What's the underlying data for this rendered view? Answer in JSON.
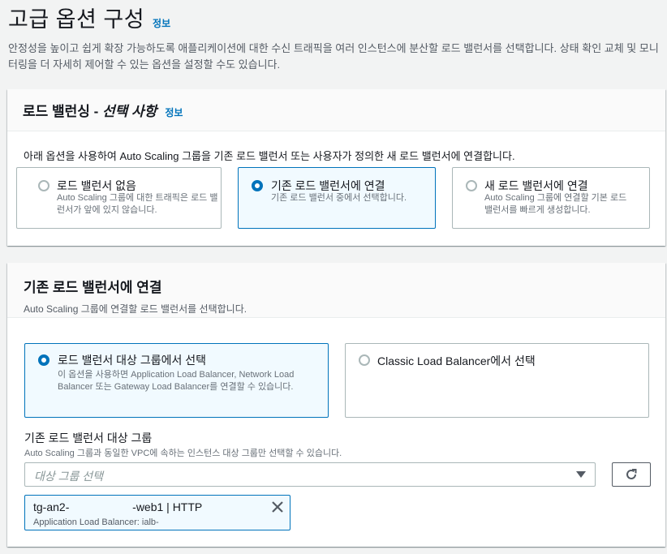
{
  "header": {
    "title": "고급 옵션 구성",
    "info": "정보",
    "description": "안정성을 높이고 쉽게 확장 가능하도록 애플리케이션에 대한 수신 트래픽을 여러 인스턴스에 분산할 로드 밸런서를 선택합니다. 상태 확인 교체 및 모니터링을 더 자세히 제어할 수 있는 옵션을 설정할 수도 있습니다."
  },
  "load_balancing": {
    "title_main": "로드 밸런싱 - ",
    "title_optional": "선택 사항",
    "info": "정보",
    "intro": "아래 옵션을 사용하여 Auto Scaling 그룹을 기존 로드 밸런서 또는 사용자가 정의한 새 로드 밸런서에 연결합니다.",
    "options": [
      {
        "title": "로드 밸런서 없음",
        "desc": "Auto Scaling 그룹에 대한 트래픽은 로드 밸런서가 앞에 있지 않습니다.",
        "selected": false
      },
      {
        "title": "기존 로드 밸런서에 연결",
        "desc": "기존 로드 밸런서 중에서 선택합니다.",
        "selected": true
      },
      {
        "title": "새 로드 밸런서에 연결",
        "desc": "Auto Scaling 그룹에 연결할 기본 로드 밸런서를 빠르게 생성합니다.",
        "selected": false
      }
    ]
  },
  "attach_existing": {
    "title": "기존 로드 밸런서에 연결",
    "description": "Auto Scaling 그룹에 연결할 로드 밸런서를 선택합니다.",
    "options": [
      {
        "title": "로드 밸런서 대상 그룹에서 선택",
        "desc": "이 옵션을 사용하면 Application Load Balancer, Network Load Balancer 또는 Gateway Load Balancer를 연결할 수 있습니다.",
        "selected": true
      },
      {
        "title": "Classic Load Balancer에서 선택",
        "desc": "",
        "selected": false
      }
    ],
    "target_group": {
      "label": "기존 로드 밸런서 대상 그룹",
      "desc": "Auto Scaling 그룹과 동일한 VPC에 속하는 인스턴스 대상 그룹만 선택할 수 있습니다.",
      "placeholder": "대상 그룹 선택",
      "selected_title": "tg-an2-                    -web1 | HTTP",
      "selected_desc": "Application Load Balancer: ialb-"
    }
  },
  "colors": {
    "accent": "#0073bb",
    "border": "#aab7b8",
    "background": "#f2f3f3"
  },
  "icons": {
    "refresh": "refresh-icon",
    "dropdown": "caret-down-icon",
    "remove": "close-icon"
  }
}
